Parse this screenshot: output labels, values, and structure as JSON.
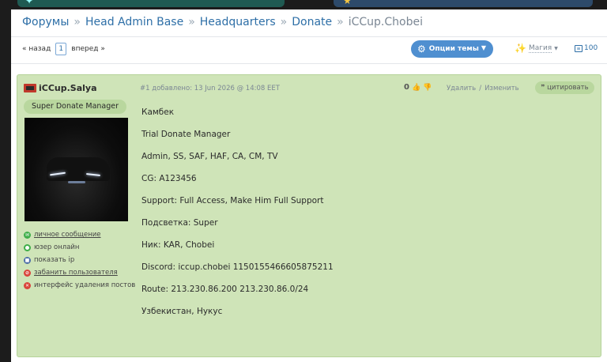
{
  "breadcrumb": {
    "items": [
      "Форумы",
      "Head Admin Base",
      "Headquarters",
      "Donate"
    ],
    "current": "iCCup.Chobei",
    "separator": "»"
  },
  "pager": {
    "prev": "« назад",
    "page": "1",
    "next": "вперед »"
  },
  "toolbar": {
    "options_label": "Опции темы",
    "magic_label": "Магия",
    "counter": "100"
  },
  "post": {
    "author": "iCCup.Salya",
    "rank": "Super Donate Manager",
    "meta": "#1 добавлено: 13 Jun 2026 @ 14:08 EET",
    "rating": "0",
    "delete_label": "Удалить",
    "slash": "/",
    "edit_label": "Изменить",
    "quote_label": "цитировать",
    "actions": [
      {
        "label": "личное сообщение",
        "icon": "message-icon"
      },
      {
        "label": "юзер онлайн",
        "icon": "online-icon"
      },
      {
        "label": "показать ip",
        "icon": "ip-icon"
      },
      {
        "label": "забанить пользователя",
        "icon": "ban-icon"
      },
      {
        "label": "интерфейс удаления постов",
        "icon": "delete-posts-icon"
      }
    ],
    "lines": [
      "Камбек",
      "Trial Donate Manager",
      "Admin, SS, SAF, HAF, CA, CM, TV",
      "CG: A123456",
      "Support: Full Access, Make Him Full Support",
      "Подсветка: Super",
      "Ник: KAR, Chobei",
      "Discord: iccup.chobei 1150155466605875211",
      "Route: 213.230.86.200 213.230.86.0/24",
      "Узбекистан, Нукус"
    ]
  },
  "colors": {
    "post_bg": "#cfe4b8",
    "link": "#2e6fa7",
    "button": "#4f8fd0"
  }
}
